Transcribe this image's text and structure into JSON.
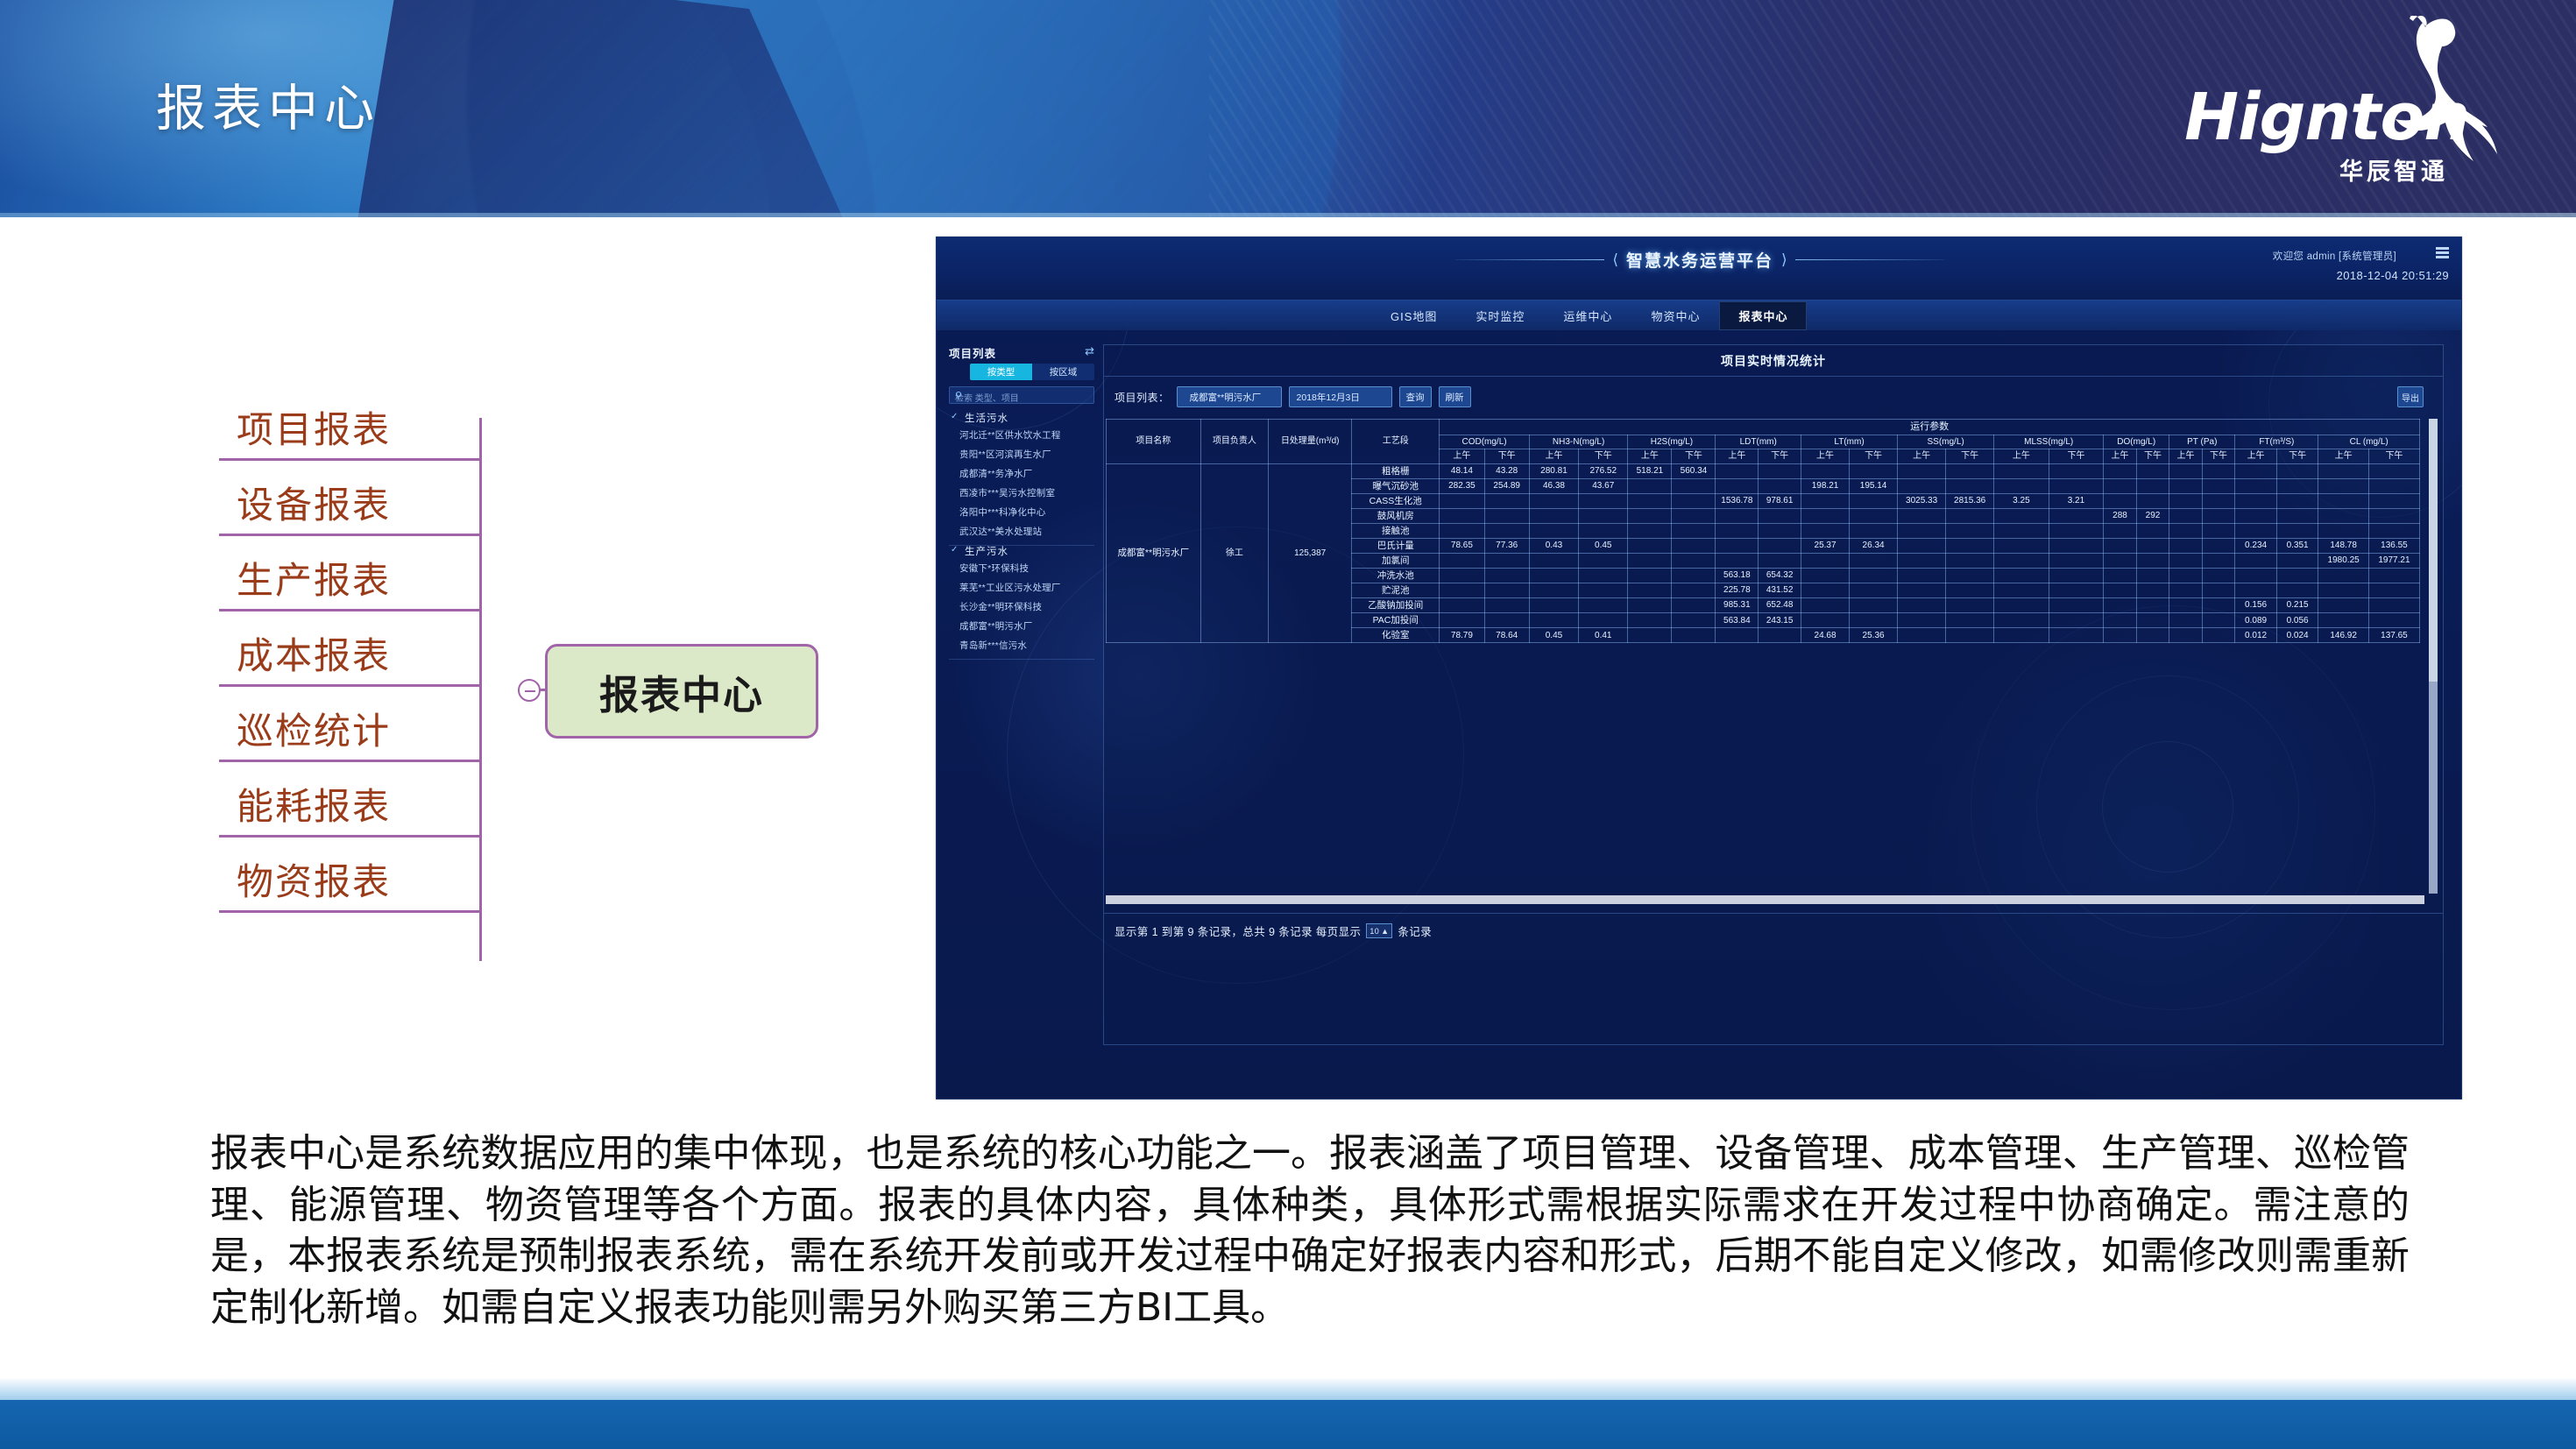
{
  "slide": {
    "banner_title": "报表中心",
    "logo_text": "Hignton",
    "logo_sub": "华辰智通"
  },
  "mindmap": {
    "center": "报表中心",
    "branches": [
      "项目报表",
      "设备报表",
      "生产报表",
      "成本报表",
      "巡检统计",
      "能耗报表",
      "物资报表"
    ]
  },
  "app": {
    "title": "智慧水务运营平台",
    "user": "欢迎您  admin [系统管理员]",
    "datetime": "2018-12-04 20:51:29",
    "nav": [
      {
        "label": "GIS地图",
        "active": false
      },
      {
        "label": "实时监控",
        "active": false
      },
      {
        "label": "运维中心",
        "active": false
      },
      {
        "label": "物资中心",
        "active": false
      },
      {
        "label": "报表中心",
        "active": true
      }
    ],
    "sidebar": {
      "title": "项目列表",
      "tabs": [
        {
          "label": "按类型",
          "active": true
        },
        {
          "label": "按区域",
          "active": false
        }
      ],
      "search_placeholder": "检索 类型、项目",
      "groups": [
        {
          "name": "生活污水",
          "items": [
            "河北迁**区供水饮水工程",
            "贵阳**区河滨再生水厂",
            "成都清**务净水厂",
            "西凌市***吴污水控制室",
            "洛阳中***科净化中心",
            "武汉达**美水处理站"
          ]
        },
        {
          "name": "生产污水",
          "items": [
            "安徽下*环保科技",
            "莱芜**工业区污水处理厂",
            "长沙金**明环保科技",
            "成都富**明污水厂",
            "青岛新***信污水"
          ]
        }
      ]
    },
    "main": {
      "title": "项目实时情况统计",
      "toolbar": {
        "list_label": "项目列表：",
        "project_value": "成都富**明污水厂",
        "date_value": "2018年12月3日",
        "query_label": "查询",
        "refresh_label": "刷新",
        "export_label": "导出"
      },
      "table": {
        "group_header": "运行参数",
        "fixed_headers": [
          "项目名称",
          "项目负责人",
          "日处理量(m³/d)",
          "工艺段"
        ],
        "param_headers": [
          "COD(mg/L)",
          "NH3-N(mg/L)",
          "H2S(mg/L)",
          "LDT(mm)",
          "LT(mm)",
          "SS(mg/L)",
          "MLSS(mg/L)",
          "DO(mg/L)",
          "PT (Pa)",
          "FT(m³/S)",
          "CL (mg/L)"
        ],
        "sub_headers": [
          "上午",
          "下午"
        ],
        "project_name": "成都富**明污水厂",
        "project_owner": "徐工",
        "daily_capacity": "125,387",
        "rows": [
          {
            "stage": "粗格栅",
            "vals": [
              "48.14",
              "43.28",
              "280.81",
              "276.52",
              "518.21",
              "560.34",
              "",
              "",
              "",
              "",
              "",
              "",
              "",
              "",
              "",
              "",
              "",
              "",
              "",
              "",
              "",
              ""
            ]
          },
          {
            "stage": "曝气沉砂池",
            "vals": [
              "282.35",
              "254.89",
              "46.38",
              "43.67",
              "",
              "",
              "",
              "",
              "198.21",
              "195.14",
              "",
              "",
              "",
              "",
              "",
              "",
              "",
              "",
              "",
              "",
              "",
              ""
            ]
          },
          {
            "stage": "CASS生化池",
            "vals": [
              "",
              "",
              "",
              "",
              "",
              "",
              "1536.78",
              "978.61",
              "",
              "",
              "3025.33",
              "2815.36",
              "3.25",
              "3.21",
              "",
              "",
              "",
              "",
              "",
              "",
              "",
              ""
            ]
          },
          {
            "stage": "鼓风机房",
            "vals": [
              "",
              "",
              "",
              "",
              "",
              "",
              "",
              "",
              "",
              "",
              "",
              "",
              "",
              "",
              "288",
              "292",
              "",
              "",
              "",
              "",
              "",
              ""
            ]
          },
          {
            "stage": "接触池",
            "vals": [
              "",
              "",
              "",
              "",
              "",
              "",
              "",
              "",
              "",
              "",
              "",
              "",
              "",
              "",
              "",
              "",
              "",
              "",
              "",
              "",
              "",
              ""
            ]
          },
          {
            "stage": "巴氏计量",
            "vals": [
              "78.65",
              "77.36",
              "0.43",
              "0.45",
              "",
              "",
              "",
              "",
              "25.37",
              "26.34",
              "",
              "",
              "",
              "",
              "",
              "",
              "",
              "",
              "0.234",
              "0.351",
              "148.78",
              "136.55"
            ]
          },
          {
            "stage": "加氯间",
            "vals": [
              "",
              "",
              "",
              "",
              "",
              "",
              "",
              "",
              "",
              "",
              "",
              "",
              "",
              "",
              "",
              "",
              "",
              "",
              "",
              "",
              "1980.25",
              "1977.21"
            ]
          },
          {
            "stage": "冲洗水池",
            "vals": [
              "",
              "",
              "",
              "",
              "",
              "",
              "563.18",
              "654.32",
              "",
              "",
              "",
              "",
              "",
              "",
              "",
              "",
              "",
              "",
              "",
              "",
              "",
              ""
            ]
          },
          {
            "stage": "贮泥池",
            "vals": [
              "",
              "",
              "",
              "",
              "",
              "",
              "225.78",
              "431.52",
              "",
              "",
              "",
              "",
              "",
              "",
              "",
              "",
              "",
              "",
              "",
              "",
              "",
              ""
            ]
          },
          {
            "stage": "乙酸钠加投间",
            "vals": [
              "",
              "",
              "",
              "",
              "",
              "",
              "985.31",
              "652.48",
              "",
              "",
              "",
              "",
              "",
              "",
              "",
              "",
              "",
              "",
              "0.156",
              "0.215",
              "",
              ""
            ]
          },
          {
            "stage": "PAC加投间",
            "vals": [
              "",
              "",
              "",
              "",
              "",
              "",
              "563.84",
              "243.15",
              "",
              "",
              "",
              "",
              "",
              "",
              "",
              "",
              "",
              "",
              "0.089",
              "0.056",
              "",
              ""
            ]
          },
          {
            "stage": "化验室",
            "vals": [
              "78.79",
              "78.64",
              "0.45",
              "0.41",
              "",
              "",
              "",
              "",
              "24.68",
              "25.36",
              "",
              "",
              "",
              "",
              "",
              "",
              "",
              "",
              "0.012",
              "0.024",
              "146.92",
              "137.65"
            ]
          }
        ]
      },
      "pager": {
        "text_before": "显示第 1 到第 9 条记录，总共 9 条记录 每页显示",
        "page_size": "10",
        "text_after": "条记录"
      }
    }
  },
  "body_text": "报表中心是系统数据应用的集中体现，也是系统的核心功能之一。报表涵盖了项目管理、设备管理、成本管理、生产管理、巡检管理、能源管理、物资管理等各个方面。报表的具体内容，具体种类，具体形式需根据实际需求在开发过程中协商确定。需注意的是，本报表系统是预制报表系统，需在系统开发前或开发过程中确定好报表内容和形式，后期不能自定义修改，如需修改则需重新定制化新增。如需自定义报表功能则需另外购买第三方BI工具。"
}
